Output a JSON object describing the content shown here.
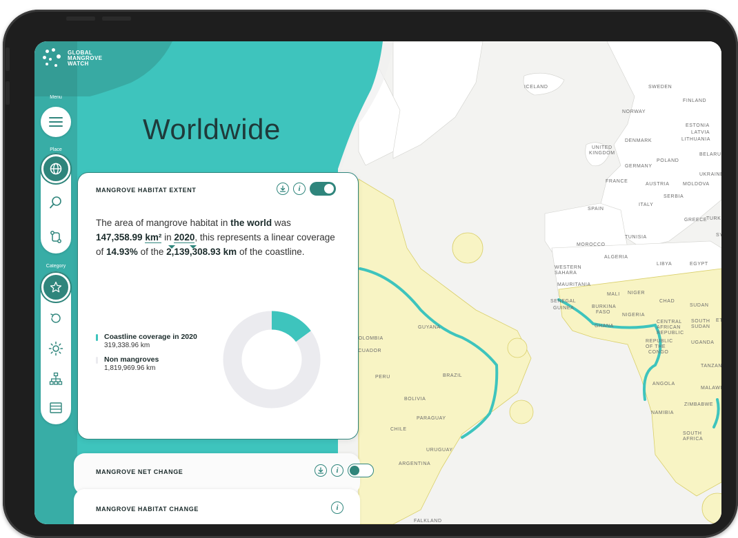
{
  "brand": {
    "name_line1": "GLOBAL",
    "name_line2": "MANGROVE",
    "name_line3": "WATCH"
  },
  "sidebar": {
    "menu_label": "Menu",
    "place_label": "Place",
    "category_label": "Category",
    "place_items": [
      "globe-icon",
      "search-icon",
      "route-icon"
    ],
    "category_items": [
      "star-icon",
      "history-icon",
      "sun-icon",
      "hierarchy-icon",
      "layers-icon"
    ]
  },
  "page": {
    "title": "Worldwide"
  },
  "widgets": [
    {
      "title": "MANGROVE HABITAT EXTENT",
      "toggle": "on",
      "summary": {
        "t1": "The area of mangrove habitat in ",
        "b1": "the world",
        "t2": " was ",
        "value": "147,358.99",
        "unit": "km²",
        "t3": " in ",
        "year": "2020",
        "t4": ", this represents a linear coverage of ",
        "pct": "14.93%",
        "t5": " of the ",
        "coast": "2,139,308.93 km",
        "t6": " of the coastline."
      },
      "legend": [
        {
          "label": "Coastline coverage in 2020",
          "value": "319,338.96 km",
          "color": "#3ec4bd"
        },
        {
          "label": "Non mangroves",
          "value": "1,819,969.96 km",
          "color": "#ebebef"
        }
      ],
      "chart_data": {
        "type": "pie",
        "categories": [
          "Coastline coverage in 2020",
          "Non mangroves"
        ],
        "values": [
          319338.96,
          1819969.96
        ],
        "colors": [
          "#3ec4bd",
          "#ebebef"
        ]
      }
    },
    {
      "title": "MANGROVE NET CHANGE",
      "toggle": "off"
    },
    {
      "title": "MANGROVE HABITAT CHANGE"
    }
  ],
  "map_labels": [
    "ICELAND",
    "SWEDEN",
    "FINLAND",
    "NORWAY",
    "ESTONIA",
    "LATVIA",
    "LITHUANIA",
    "DENMARK",
    "UNITED",
    "KINGDOM",
    "BELARUS",
    "POLAND",
    "GERMANY",
    "UKRAINE",
    "FRANCE",
    "AUSTRIA",
    "MOLDOVA",
    "SERBIA",
    "SPAIN",
    "ITALY",
    "GREECE",
    "TURKE",
    "TUNISIA",
    "MOROCCO",
    "ALGERIA",
    "LIBYA",
    "EGYPT",
    "WESTERN",
    "SAHARA",
    "MAURITANIA",
    "MALI",
    "NIGER",
    "CHAD",
    "SUDAN",
    "SENEGAL",
    "GUINEA",
    "BURKINA",
    "FASO",
    "NIGERIA",
    "GHANA",
    "CENTRAL",
    "AFRICAN",
    "REPUBLIC",
    "SOUTH",
    "SUDAN",
    "REPUBLIC",
    "OF THE",
    "CONGO",
    "UGANDA",
    "TANZAN",
    "ANGOLA",
    "MALAWI",
    "ZIMBABWE",
    "NAMIBIA",
    "SOUTH",
    "AFRICA",
    "GUYANA",
    "COLOMBIA",
    "ECUADOR",
    "PERU",
    "BRAZIL",
    "BOLIVIA",
    "PARAGUAY",
    "CHILE",
    "URUGUAY",
    "ARGENTINA",
    "FALKLAND",
    "ET",
    "SY"
  ],
  "colors": {
    "accent": "#2f857c",
    "teal_light": "#3ec4bd",
    "land_highlight": "#f8f4c4",
    "map_bg": "#f3f3f1"
  }
}
